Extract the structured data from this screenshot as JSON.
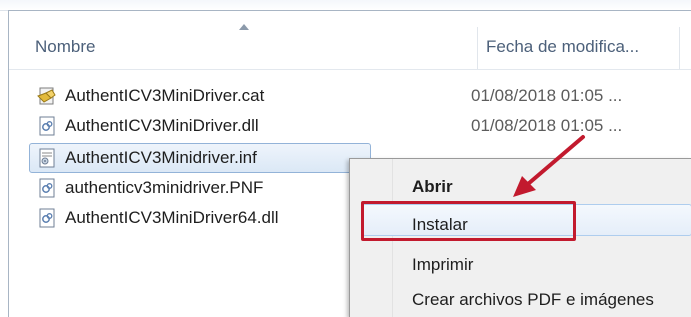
{
  "header": {
    "col_name": "Nombre",
    "col_date": "Fecha de modifica..."
  },
  "files": [
    {
      "name": "AuthentICV3MiniDriver.cat",
      "date": "01/08/2018 01:05 ...",
      "icon": "catalog-file-icon"
    },
    {
      "name": "AuthentICV3MiniDriver.dll",
      "date": "01/08/2018 01:05 ...",
      "icon": "dll-file-icon"
    },
    {
      "name": "AuthentICV3Minidriver.inf",
      "date": "",
      "icon": "inf-file-icon",
      "selected": true
    },
    {
      "name": "authenticv3minidriver.PNF",
      "date": "",
      "icon": "pnf-file-icon"
    },
    {
      "name": "AuthentICV3MiniDriver64.dll",
      "date": "",
      "icon": "dll-file-icon"
    }
  ],
  "context_menu": {
    "items": [
      {
        "label": "Abrir",
        "default": true
      },
      {
        "label": "Instalar",
        "highlighted": true
      },
      {
        "label": "Imprimir"
      },
      {
        "label": "Crear archivos PDF e imágenes"
      }
    ]
  },
  "annotation": {
    "arrow_color": "#c21a2e",
    "box_color": "#c21a2e"
  }
}
